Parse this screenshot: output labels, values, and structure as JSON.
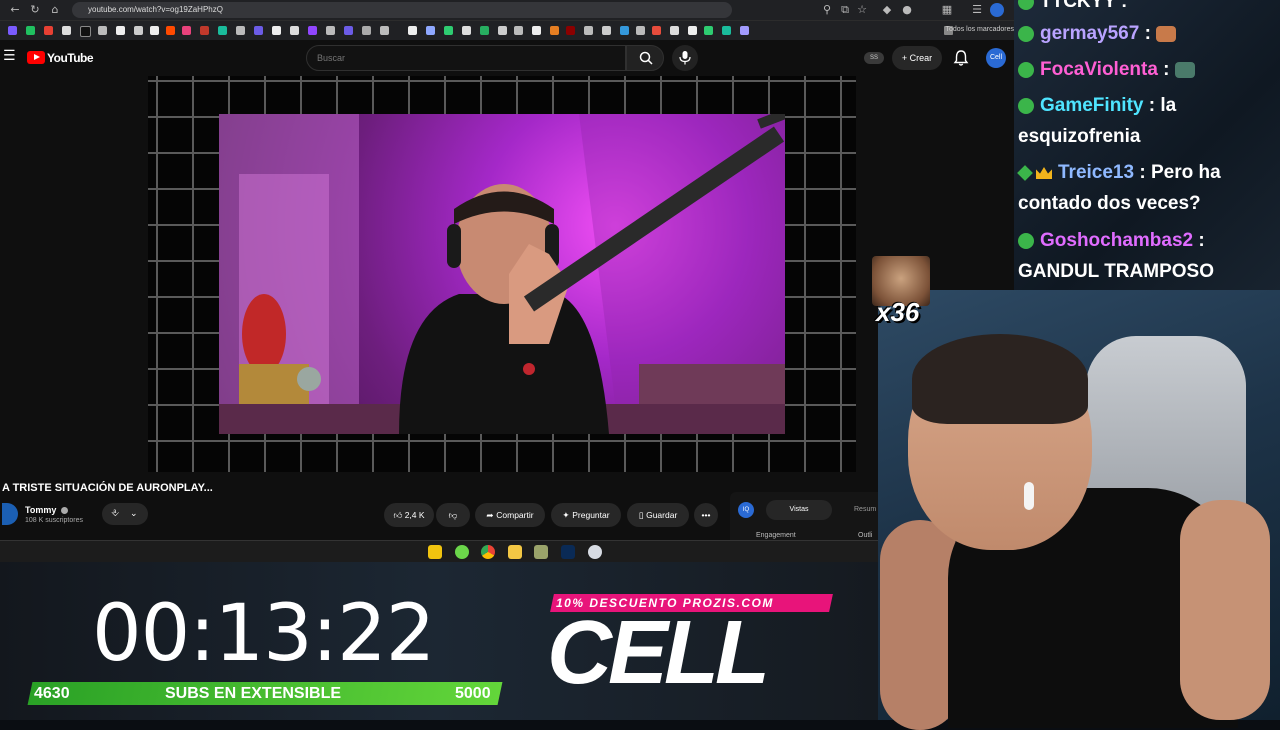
{
  "browser": {
    "url": "youtube.com/watch?v=og19ZaHPhzQ",
    "bookmarks_all": "Todos los marcadores"
  },
  "youtube": {
    "brand": "YouTube",
    "search_placeholder": "Buscar",
    "ss_badge": "SS",
    "create_label": "Crear",
    "avatar_text": "Cell",
    "video": {
      "title": "A TRISTE SITUACIÓN DE AURONPLAY...",
      "channel_name": "Tommy",
      "channel_verified": "verified-icon",
      "subscribers": "108 K suscriptores",
      "likes": "2,4 K",
      "share_label": "Compartir",
      "ask_label": "Preguntar",
      "save_label": "Guardar"
    },
    "insights": {
      "logo": "IQ",
      "tab_active": "Vistas",
      "tab_other": "Resum",
      "col1": "Engagement",
      "col2": "Outli"
    }
  },
  "chat": {
    "messages": [
      {
        "user": "TTCKYY",
        "color": "#ffffff",
        "text": ""
      },
      {
        "user": "germay567",
        "color": "#b9a3ff",
        "text": ""
      },
      {
        "user": "FocaViolenta",
        "color": "#ff5fd4",
        "text": ""
      },
      {
        "user": "GameFinity",
        "color": "#4fe4ff",
        "text": "la"
      },
      {
        "user": "",
        "color": "#ffffff",
        "text": "esquizofrenia"
      },
      {
        "user": "Treice13",
        "color": "#8fb9ff",
        "text": "Pero ha"
      },
      {
        "user": "",
        "color": "#ffffff",
        "text": "contado dos veces?"
      },
      {
        "user": "Goshochambas2",
        "color": "#e06cff",
        "text": ""
      },
      {
        "user": "",
        "color": "#ffffff",
        "text": "GANDUL TRAMPOSO"
      }
    ],
    "emote_count": "x36"
  },
  "overlay": {
    "timer": "00:13:22",
    "subs_start": "4630",
    "subs_label": "SUBS EN EXTENSIBLE",
    "subs_goal": "5000",
    "promo": "10% DESCUENTO PROZIS.COM",
    "brand": "CELL"
  },
  "colors": {
    "youtube_red": "#ff0000",
    "subs_bar": "#3cb22f",
    "promo_pink": "#e8147a"
  }
}
